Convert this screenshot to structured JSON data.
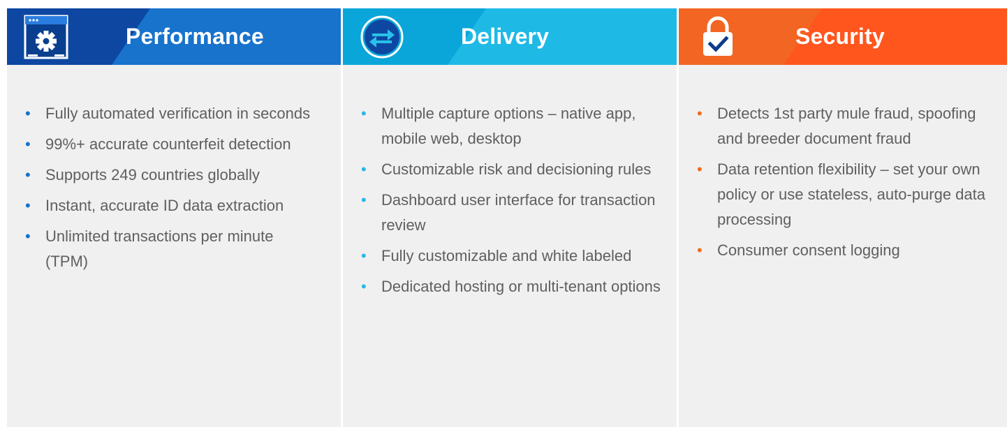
{
  "colors": {
    "performance_base": "#0d47a1",
    "performance_accent": "#1976d2",
    "delivery_base": "#0aa6d9",
    "delivery_accent": "#22bde8",
    "security_base": "#f26522",
    "security_accent": "#ff5a1f",
    "panel_bg": "#f0f0f0",
    "body_text": "#5f5f5f"
  },
  "columns": [
    {
      "title": "Performance",
      "icon": "settings-window-icon",
      "bullets": [
        "Fully automated verification in seconds",
        "99%+ accurate counterfeit detection",
        "Supports 249 countries globally",
        "Instant, accurate ID data extraction",
        "Unlimited transactions per minute (TPM)"
      ]
    },
    {
      "title": "Delivery",
      "icon": "transfer-arrows-icon",
      "bullets": [
        "Multiple capture options – native app, mobile web, desktop",
        "Customizable risk and decisioning rules",
        "Dashboard user interface for transaction review",
        "Fully customizable and white labeled",
        "Dedicated hosting or multi-tenant options"
      ]
    },
    {
      "title": "Security",
      "icon": "padlock-check-icon",
      "bullets": [
        "Detects 1st party mule fraud, spoofing and breeder document fraud",
        "Data retention flexibility – set your own policy or use stateless, auto-purge data processing",
        "Consumer consent logging"
      ]
    }
  ]
}
